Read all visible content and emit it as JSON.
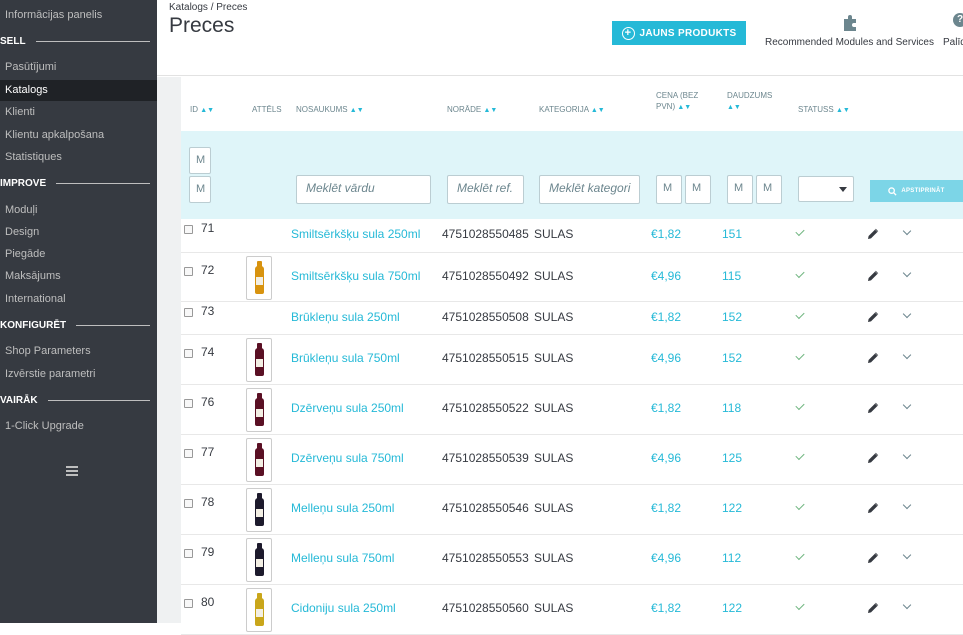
{
  "sidebar": {
    "dashboard": "Informācijas panelis",
    "sections": {
      "sell": "SELL",
      "improve": "IMPROVE",
      "configure": "KONFIGURĒT",
      "more": "VAIRĀK"
    },
    "items": {
      "orders": "Pasūtījumi",
      "catalog": "Katalogs",
      "customers": "Klienti",
      "customer_service": "Klientu apkalpošana",
      "stats": "Statistiques",
      "modules": "Moduļi",
      "design": "Design",
      "shipping": "Piegāde",
      "payment": "Maksājums",
      "international": "International",
      "shop_parameters": "Shop Parameters",
      "advanced": "Izvērstie parametri",
      "upgrade": "1-Click Upgrade"
    }
  },
  "header": {
    "breadcrumb": "Katalogs / Preces",
    "title": "Preces",
    "new_product": "JAUNS PRODUKTS",
    "recommended": "Recommended Modules and Services",
    "help": "Palīdz"
  },
  "table": {
    "columns": {
      "id": "ID",
      "image": "ATTĒLS",
      "name": "NOSAUKUMS",
      "ref_l1": "NORĀDE",
      "category": "KATEGORIJA",
      "price_l1": "CENA (BEZ",
      "price_l2": "PVN)",
      "qty": "DAUDZUMS",
      "status": "STATUSS"
    },
    "filters": {
      "id_min": "M",
      "id_max": "M",
      "name_placeholder": "Meklēt vārdu",
      "ref_placeholder": "Meklēt ref.",
      "category_placeholder": "Meklēt kategori",
      "price_min": "M",
      "price_max": "M",
      "qty_min": "M",
      "qty_max": "M",
      "apply": "APSTIPRINĀT"
    },
    "rows": [
      {
        "id": "71",
        "name": "Smiltsērkšķu sula 250ml",
        "ref": "4751028550485",
        "category": "SULAS",
        "price": "€1,82",
        "qty": "151",
        "image": "none"
      },
      {
        "id": "72",
        "name": "Smiltsērkšķu sula 750ml",
        "ref": "4751028550492",
        "category": "SULAS",
        "price": "€4,96",
        "qty": "115",
        "image": "orange"
      },
      {
        "id": "73",
        "name": "Brūkleņu sula 250ml",
        "ref": "4751028550508",
        "category": "SULAS",
        "price": "€1,82",
        "qty": "152",
        "image": "none"
      },
      {
        "id": "74",
        "name": "Brūkleņu sula 750ml",
        "ref": "4751028550515",
        "category": "SULAS",
        "price": "€4,96",
        "qty": "152",
        "image": "red"
      },
      {
        "id": "76",
        "name": "Dzērveņu sula 250ml",
        "ref": "4751028550522",
        "category": "SULAS",
        "price": "€1,82",
        "qty": "118",
        "image": "red"
      },
      {
        "id": "77",
        "name": "Dzērveņu sula 750ml",
        "ref": "4751028550539",
        "category": "SULAS",
        "price": "€4,96",
        "qty": "125",
        "image": "red"
      },
      {
        "id": "78",
        "name": "Melleņu sula 250ml",
        "ref": "4751028550546",
        "category": "SULAS",
        "price": "€1,82",
        "qty": "122",
        "image": "dark"
      },
      {
        "id": "79",
        "name": "Melleņu sula 750ml",
        "ref": "4751028550553",
        "category": "SULAS",
        "price": "€4,96",
        "qty": "112",
        "image": "dark"
      },
      {
        "id": "80",
        "name": "Cidoniju sula 250ml",
        "ref": "4751028550560",
        "category": "SULAS",
        "price": "€1,82",
        "qty": "122",
        "image": "yellow"
      }
    ]
  },
  "colors": {
    "accent": "#25b9d7",
    "sidebar_bg": "#363a41",
    "filter_bg": "#dff5f9",
    "status_ok": "#70b580"
  }
}
